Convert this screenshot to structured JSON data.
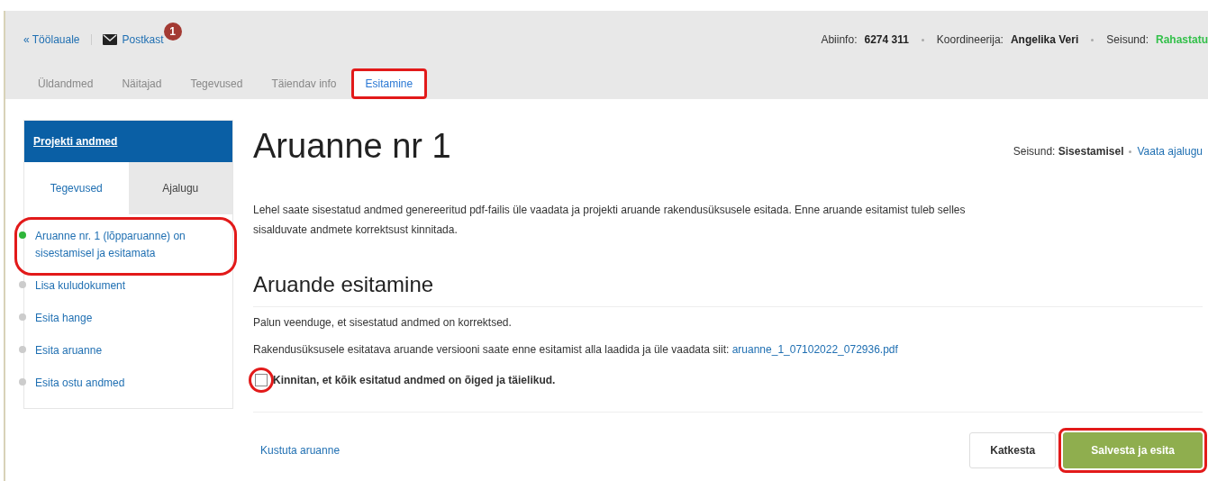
{
  "header": {
    "back_link": "« Töölauale",
    "mailbox": {
      "label": "Postkast",
      "badge": "1"
    },
    "info": [
      {
        "label": "Abiinfo:",
        "value": "6274 311",
        "kind": "plain"
      },
      {
        "label": "Koordineerija:",
        "value": "Angelika Veri",
        "kind": "plain"
      },
      {
        "label": "Seisund:",
        "value": "Rahastatu",
        "kind": "status"
      }
    ]
  },
  "tabs": [
    {
      "label": "Üldandmed",
      "selected": false,
      "circled": false
    },
    {
      "label": "Näitajad",
      "selected": false,
      "circled": false
    },
    {
      "label": "Tegevused",
      "selected": false,
      "circled": false
    },
    {
      "label": "Täiendav info",
      "selected": false,
      "circled": false
    },
    {
      "label": "Esitamine",
      "selected": true,
      "circled": true
    }
  ],
  "sidebar": {
    "title": "Projekti andmed",
    "tabs": [
      {
        "label": "Tegevused",
        "selected": true
      },
      {
        "label": "Ajalugu",
        "selected": false
      }
    ],
    "items": [
      {
        "label": "Aruanne nr. 1 (lõpparuanne) on sisestamisel ja esitamata",
        "active": true,
        "circled": true
      },
      {
        "label": "Lisa kuludokument",
        "active": false,
        "circled": false
      },
      {
        "label": "Esita hange",
        "active": false,
        "circled": false
      },
      {
        "label": "Esita aruanne",
        "active": false,
        "circled": false
      },
      {
        "label": "Esita ostu andmed",
        "active": false,
        "circled": false
      }
    ]
  },
  "main": {
    "title": "Aruanne nr 1",
    "status_label": "Seisund:",
    "status_value": "Sisestamisel",
    "history_link": "Vaata ajalugu",
    "intro": "Lehel saate sisestatud andmed genereeritud pdf-failis üle vaadata ja projekti aruande rakendusüksusele esitada. Enne aruande esitamist tuleb selles sisalduvate andmete korrektsust kinnitada.",
    "section_title": "Aruande esitamine",
    "note": "Palun veenduge, et sisestatud andmed on korrektsed.",
    "download_text": "Rakendusüksusele esitatava aruande versiooni saate enne esitamist alla laadida ja üle vaadata siit:",
    "download_link": "aruanne_1_07102022_072936.pdf",
    "confirm": {
      "label": "Kinnitan, et kõik esitatud andmed on õiged ja täielikud.",
      "checked": false,
      "circled": true
    },
    "delete_link": "Kustuta aruanne",
    "cancel_button": "Katkesta",
    "submit_button": {
      "label": "Salvesta ja esita",
      "circled": true
    }
  }
}
